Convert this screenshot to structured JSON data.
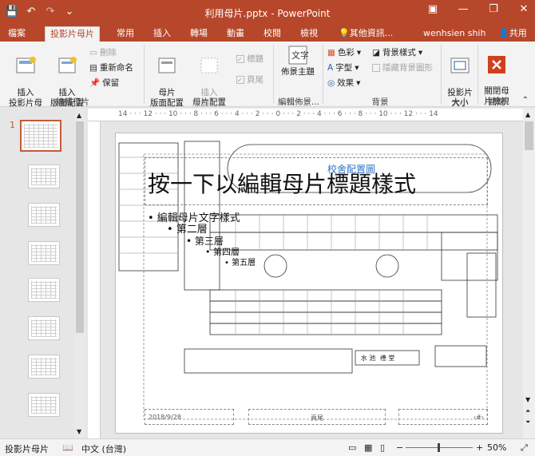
{
  "window": {
    "title": "利用母片.pptx - PowerPoint"
  },
  "tabs": [
    {
      "label": "檔案"
    },
    {
      "label": "投影片母片"
    },
    {
      "label": "常用"
    },
    {
      "label": "插入"
    },
    {
      "label": "轉場"
    },
    {
      "label": "動畫"
    },
    {
      "label": "校閱"
    },
    {
      "label": "檢視"
    },
    {
      "label": "其他資訊..."
    }
  ],
  "user": {
    "name": "wenhsien shih",
    "share": "共用"
  },
  "ribbon": {
    "edit_master": {
      "insert_slide_master": "插入\n投影片母片",
      "insert_layout": "插入\n版面配置",
      "delete": "刪除",
      "rename": "重新命名",
      "preserve": "保留",
      "group_label": "編輯母片"
    },
    "master_layout": {
      "master_layout_btn": "母片\n版面配置",
      "insert_placeholder": "插入\n版面配置區",
      "title_cb": "標題",
      "footer_cb": "頁尾",
      "group_label": "母片配置"
    },
    "edit_theme": {
      "themes": "佈景主題",
      "group_label": "編輯佈景..."
    },
    "background": {
      "colors": "色彩",
      "fonts": "字型",
      "effects": "效果",
      "bg_styles": "背景樣式",
      "hide_bg": "隱藏背景圖形",
      "group_label": "背景"
    },
    "size": {
      "slide_size": "投影片\n大小",
      "group_label": "大小"
    },
    "close": {
      "close_master": "關閉母\n片檢視",
      "group_label": "關閉"
    }
  },
  "thumbs": {
    "first_number": "1"
  },
  "ruler_text": "14 · · · 12 · · · 10 · · · 8 · · · 6 · · · 4 · · · 2 · · · 0 · · · 2 · · · 4 · · · 6 · · · 8 · · · 10 · · · 12 · · · 14",
  "slide": {
    "title": "按一下以編輯母片標題樣式",
    "overlay_title": "校舍配置圖",
    "levels": [
      "• 編輯母片文字樣式",
      "• 第二層",
      "• 第三層",
      "• 第四層",
      "• 第五層"
    ],
    "date": "2018/9/28",
    "footer": "頁尾",
    "page": "‹#›",
    "pool_label": "水 池",
    "gym_label": "禮 堂"
  },
  "status": {
    "view": "投影片母片",
    "lang": "中文 (台灣)",
    "zoom": "50%"
  }
}
